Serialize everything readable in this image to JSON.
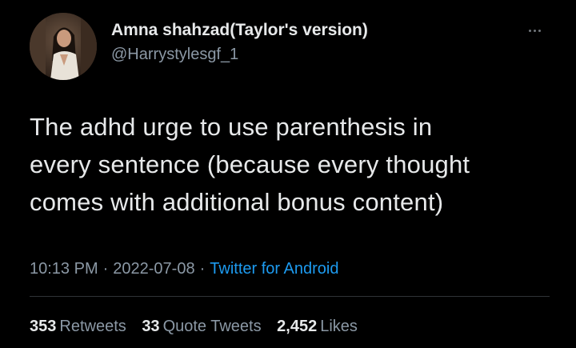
{
  "author": {
    "display_name": "Amna shahzad(Taylor's version)",
    "handle": "@Harrystylesgf_1",
    "avatar_icon": "profile-photo"
  },
  "more_icon": "more-horizontal-icon",
  "tweet": {
    "lines": [
      "The adhd urge to use parenthesis in",
      "every sentence (because every thought",
      "comes with additional bonus content)"
    ]
  },
  "meta": {
    "time": "10:13 PM",
    "date": "2022-07-08",
    "source": "Twitter for Android",
    "separator": "·"
  },
  "stats": {
    "retweets": {
      "count": "353",
      "label": "Retweets"
    },
    "quote_tweets": {
      "count": "33",
      "label": "Quote Tweets"
    },
    "likes": {
      "count": "2,452",
      "label": "Likes"
    }
  },
  "colors": {
    "background": "#000000",
    "primary_text": "#e7e9ea",
    "secondary_text": "#8b98a5",
    "link": "#1d9bf0",
    "divider": "#2f3336"
  }
}
